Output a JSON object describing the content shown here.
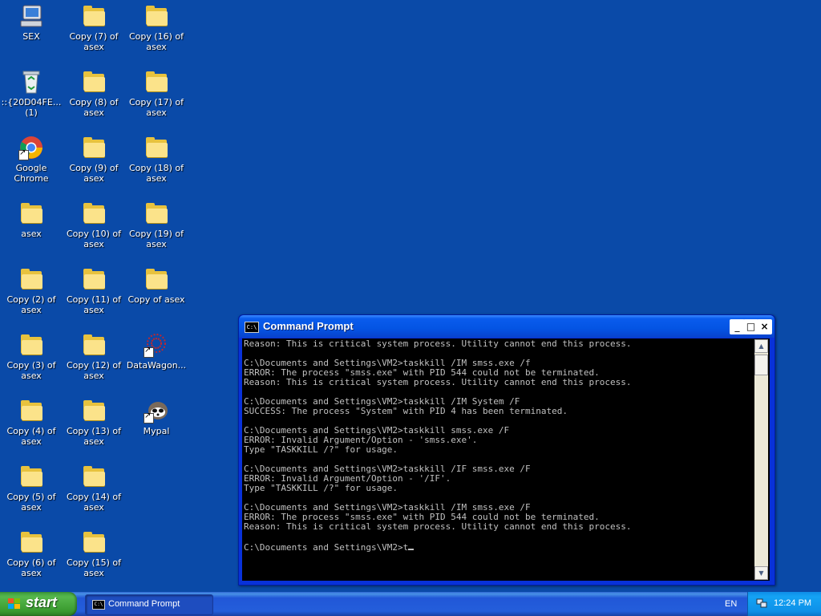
{
  "desktop": {
    "icons": [
      {
        "label": "SEX",
        "kind": "computer"
      },
      {
        "label": "::{20D04FE...\n(1)",
        "kind": "recycle"
      },
      {
        "label": "Google Chrome",
        "kind": "chrome"
      },
      {
        "label": "asex",
        "kind": "folder"
      },
      {
        "label": "Copy (2) of\nasex",
        "kind": "folder"
      },
      {
        "label": "Copy (3) of\nasex",
        "kind": "folder"
      },
      {
        "label": "Copy (4) of\nasex",
        "kind": "folder"
      },
      {
        "label": "Copy (5) of\nasex",
        "kind": "folder"
      },
      {
        "label": "Copy (6) of\nasex",
        "kind": "folder"
      },
      {
        "label": "Copy (7) of\nasex",
        "kind": "folder"
      },
      {
        "label": "Copy (8) of\nasex",
        "kind": "folder"
      },
      {
        "label": "Copy (9) of\nasex",
        "kind": "folder"
      },
      {
        "label": "Copy (10) of\nasex",
        "kind": "folder"
      },
      {
        "label": "Copy (11) of\nasex",
        "kind": "folder"
      },
      {
        "label": "Copy (12) of\nasex",
        "kind": "folder"
      },
      {
        "label": "Copy (13) of\nasex",
        "kind": "folder"
      },
      {
        "label": "Copy (14) of\nasex",
        "kind": "folder"
      },
      {
        "label": "Copy (15) of\nasex",
        "kind": "folder"
      },
      {
        "label": "Copy (16) of\nasex",
        "kind": "folder"
      },
      {
        "label": "Copy (17) of\nasex",
        "kind": "folder"
      },
      {
        "label": "Copy (18) of\nasex",
        "kind": "folder"
      },
      {
        "label": "Copy (19) of\nasex",
        "kind": "folder"
      },
      {
        "label": "Copy of asex",
        "kind": "folder"
      },
      {
        "label": "DataWagon...",
        "kind": "datawagon"
      },
      {
        "label": "Mypal",
        "kind": "mypal"
      }
    ]
  },
  "cmd_window": {
    "title": "Command Prompt",
    "icon_text": "C:\\",
    "minimize": "_",
    "maximize": "□",
    "close": "×",
    "console_lines": [
      "Reason: This is critical system process. Utility cannot end this process.",
      "",
      "C:\\Documents and Settings\\VM2>taskkill /IM smss.exe /f",
      "ERROR: The process \"smss.exe\" with PID 544 could not be terminated.",
      "Reason: This is critical system process. Utility cannot end this process.",
      "",
      "C:\\Documents and Settings\\VM2>taskkill /IM System /F",
      "SUCCESS: The process \"System\" with PID 4 has been terminated.",
      "",
      "C:\\Documents and Settings\\VM2>taskkill smss.exe /F",
      "ERROR: Invalid Argument/Option - 'smss.exe'.",
      "Type \"TASKKILL /?\" for usage.",
      "",
      "C:\\Documents and Settings\\VM2>taskkill /IF smss.exe /F",
      "ERROR: Invalid Argument/Option - '/IF'.",
      "Type \"TASKKILL /?\" for usage.",
      "",
      "C:\\Documents and Settings\\VM2>taskkill /IM smss.exe /F",
      "ERROR: The process \"smss.exe\" with PID 544 could not be terminated.",
      "Reason: This is critical system process. Utility cannot end this process.",
      ""
    ],
    "current_input": "C:\\Documents and Settings\\VM2>t"
  },
  "taskbar": {
    "start_label": "start",
    "task_label": "Command Prompt",
    "task_icon_text": "C:\\",
    "language": "EN",
    "clock": "12:24 PM"
  },
  "colors": {
    "desktop_bg": "#0a4aa8",
    "console_fg": "#c0c0c0",
    "titlebar": "#0454e3",
    "start_green": "#3a9a2f"
  }
}
